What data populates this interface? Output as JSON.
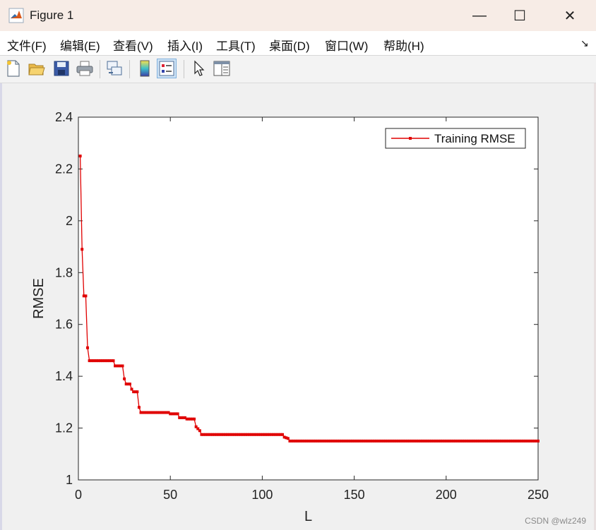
{
  "window": {
    "title": "Figure 1",
    "controls": {
      "minimize": "—",
      "maximize": "☐",
      "close": "✕"
    }
  },
  "menu": {
    "items": [
      "文件(F)",
      "编辑(E)",
      "查看(V)",
      "插入(I)",
      "工具(T)",
      "桌面(D)",
      "窗口(W)",
      "帮助(H)"
    ],
    "dock_arrow": "↘"
  },
  "toolbar": {
    "icons": [
      "new-figure-icon",
      "open-file-icon",
      "save-icon",
      "print-icon",
      "link-axes-icon",
      "colorbar-icon",
      "legend-icon",
      "pointer-icon",
      "property-inspector-icon"
    ]
  },
  "chart_data": {
    "type": "line",
    "xlabel": "L",
    "ylabel": "RMSE",
    "xlim": [
      0,
      250
    ],
    "ylim": [
      1,
      2.4
    ],
    "xticks": [
      0,
      50,
      100,
      150,
      200,
      250
    ],
    "yticks": [
      1,
      1.2,
      1.4,
      1.6,
      1.8,
      2,
      2.2,
      2.4
    ],
    "grid": false,
    "legend_position": "top-right",
    "series": [
      {
        "name": "Training RMSE",
        "color": "#e00000",
        "marker": "square",
        "points": [
          [
            1,
            2.25
          ],
          [
            2,
            1.89
          ],
          [
            3,
            1.71
          ],
          [
            4,
            1.71
          ],
          [
            5,
            1.51
          ],
          [
            6,
            1.46
          ],
          [
            10,
            1.46
          ],
          [
            15,
            1.46
          ],
          [
            19,
            1.46
          ],
          [
            20,
            1.44
          ],
          [
            24,
            1.44
          ],
          [
            25,
            1.39
          ],
          [
            26,
            1.37
          ],
          [
            28,
            1.37
          ],
          [
            29,
            1.35
          ],
          [
            30,
            1.34
          ],
          [
            32,
            1.34
          ],
          [
            33,
            1.28
          ],
          [
            34,
            1.26
          ],
          [
            40,
            1.26
          ],
          [
            49,
            1.26
          ],
          [
            50,
            1.255
          ],
          [
            54,
            1.255
          ],
          [
            55,
            1.24
          ],
          [
            58,
            1.24
          ],
          [
            59,
            1.235
          ],
          [
            63,
            1.235
          ],
          [
            64,
            1.205
          ],
          [
            66,
            1.19
          ],
          [
            67,
            1.175
          ],
          [
            80,
            1.175
          ],
          [
            100,
            1.175
          ],
          [
            111,
            1.175
          ],
          [
            112,
            1.165
          ],
          [
            114,
            1.16
          ],
          [
            115,
            1.15
          ],
          [
            130,
            1.15
          ],
          [
            150,
            1.15
          ],
          [
            175,
            1.15
          ],
          [
            200,
            1.15
          ],
          [
            225,
            1.15
          ],
          [
            250,
            1.15
          ]
        ]
      }
    ]
  },
  "watermark": "CSDN @wlz249"
}
